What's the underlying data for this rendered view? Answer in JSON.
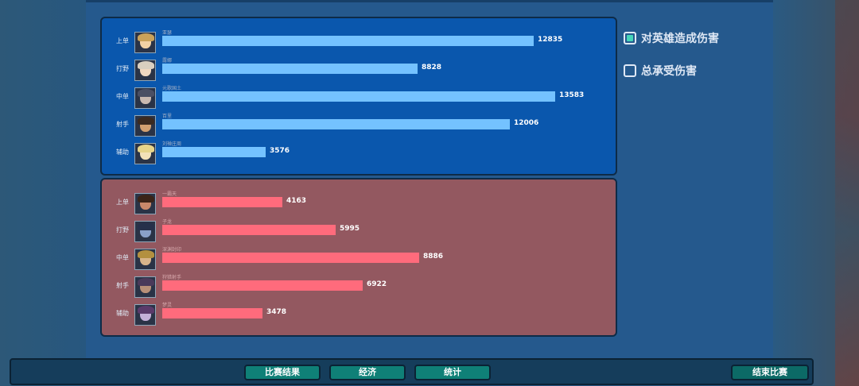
{
  "legend": {
    "hero_damage": {
      "label": "对英雄造成伤害",
      "checked": true
    },
    "damage_taken": {
      "label": "总承受伤害",
      "checked": false
    }
  },
  "teams": {
    "blue": {
      "color": "#74c2ff",
      "players": [
        {
          "role": "上单",
          "hero": "亚瑟",
          "value": 12835
        },
        {
          "role": "打野",
          "hero": "露娜",
          "value": 8828
        },
        {
          "role": "中单",
          "hero": "元歌国土",
          "value": 13583
        },
        {
          "role": "射手",
          "hero": "百里",
          "value": 12006
        },
        {
          "role": "辅助",
          "hero": "刘禅庄周",
          "value": 3576
        }
      ]
    },
    "red": {
      "color": "#ff6b7c",
      "players": [
        {
          "role": "上单",
          "hero": "一霸天",
          "value": 4163
        },
        {
          "role": "打野",
          "hero": "子龙",
          "value": 5995
        },
        {
          "role": "中单",
          "hero": "深渊封印",
          "value": 8886
        },
        {
          "role": "射手",
          "hero": "狩猎射手",
          "value": 6922
        },
        {
          "role": "辅助",
          "hero": "梦灵",
          "value": 3478
        }
      ]
    }
  },
  "scale_max": 13583,
  "bottom_bar": {
    "match_result": "比赛结果",
    "economy": "经济",
    "stats": "统计",
    "end_match": "结束比赛"
  },
  "colors": {
    "blue_bar": "#74c2ff",
    "red_bar": "#ff6b7c",
    "check_accent": "#46d6b9"
  }
}
